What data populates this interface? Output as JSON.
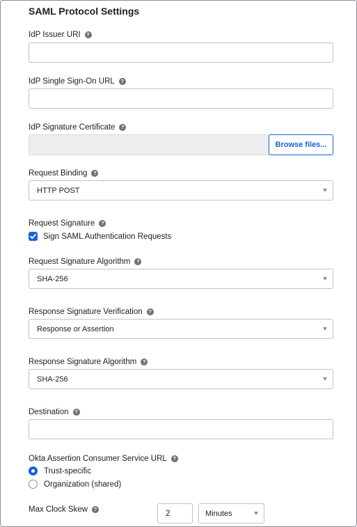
{
  "section_title": "SAML Protocol Settings",
  "help_glyph": "?",
  "fields": {
    "idp_issuer_uri": {
      "label": "IdP Issuer URI",
      "value": ""
    },
    "idp_sso_url": {
      "label": "IdP Single Sign-On URL",
      "value": ""
    },
    "idp_signature_certificate": {
      "label": "IdP Signature Certificate",
      "browse_label": "Browse files..."
    },
    "request_binding": {
      "label": "Request Binding",
      "selected": "HTTP POST"
    },
    "request_signature": {
      "label": "Request Signature",
      "checkbox_label": "Sign SAML Authentication Requests",
      "checked": true
    },
    "request_signature_algorithm": {
      "label": "Request Signature Algorithm",
      "selected": "SHA-256"
    },
    "response_signature_verification": {
      "label": "Response Signature Verification",
      "selected": "Response or Assertion"
    },
    "response_signature_algorithm": {
      "label": "Response Signature Algorithm",
      "selected": "SHA-256"
    },
    "destination": {
      "label": "Destination",
      "value": ""
    },
    "okta_acs_url": {
      "label": "Okta Assertion Consumer Service URL",
      "options": [
        "Trust-specific",
        "Organization (shared)"
      ],
      "selected": "Trust-specific"
    },
    "max_clock_skew": {
      "label": "Max Clock Skew",
      "value": "2",
      "unit": "Minutes"
    }
  },
  "colors": {
    "accent": "#1662dd",
    "border": "#c1c1c8",
    "disabled_bg": "#ededf0"
  }
}
